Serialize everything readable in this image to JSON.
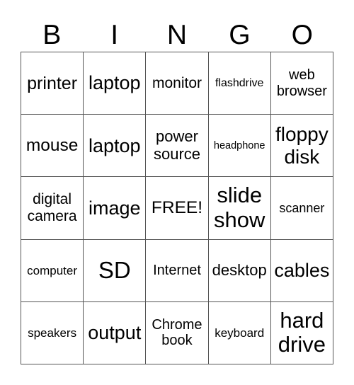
{
  "header": [
    "B",
    "I",
    "N",
    "G",
    "O"
  ],
  "cells": [
    [
      "printer",
      "laptop",
      "monitor",
      "flashdrive",
      "web browser"
    ],
    [
      "mouse",
      "laptop",
      "power source",
      "headphone",
      "floppy disk"
    ],
    [
      "digital camera",
      "image",
      "FREE!",
      "slide show",
      "scanner"
    ],
    [
      "computer",
      "SD",
      "Internet",
      "desktop",
      "cables"
    ],
    [
      "speakers",
      "output",
      "Chrome book",
      "keyboard",
      "hard drive"
    ]
  ]
}
